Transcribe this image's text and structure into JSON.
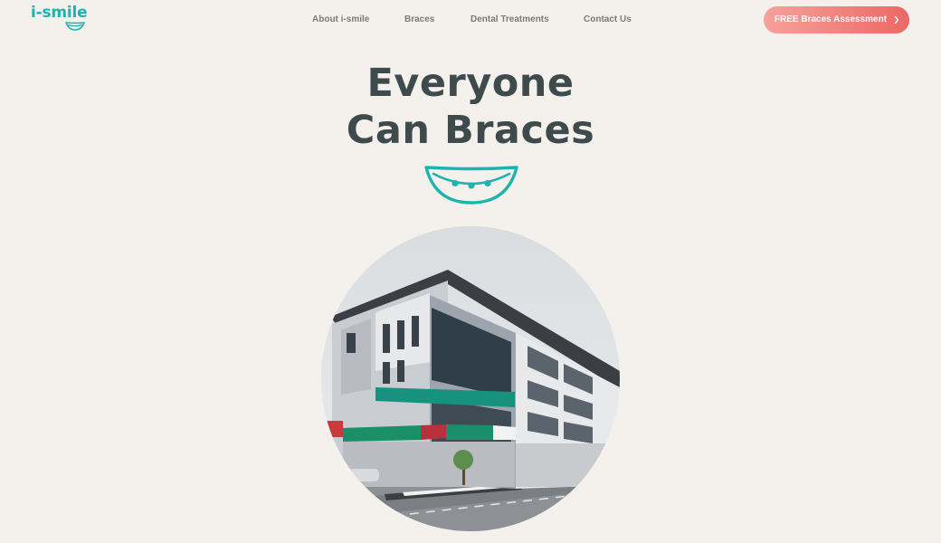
{
  "header": {
    "logo_text": "i-smile",
    "nav": [
      {
        "label": "About i-smile"
      },
      {
        "label": "Braces"
      },
      {
        "label": "Dental Treatments"
      },
      {
        "label": "Contact Us"
      }
    ],
    "cta_label": "FREE Braces Assessment",
    "cta_icon": "chevron-right-icon"
  },
  "hero": {
    "title_line1": "Everyone",
    "title_line2": "Can Braces",
    "smile_icon": "braces-smile-icon",
    "image_description_icon": "clinic-building-photo"
  },
  "colors": {
    "brand_teal": "#1fb3b0",
    "heading": "#3e4a4b",
    "nav_text": "#7a7a7a",
    "cta_start": "#f6a29c",
    "cta_end": "#ec6866",
    "background": "#f4f1ec"
  }
}
